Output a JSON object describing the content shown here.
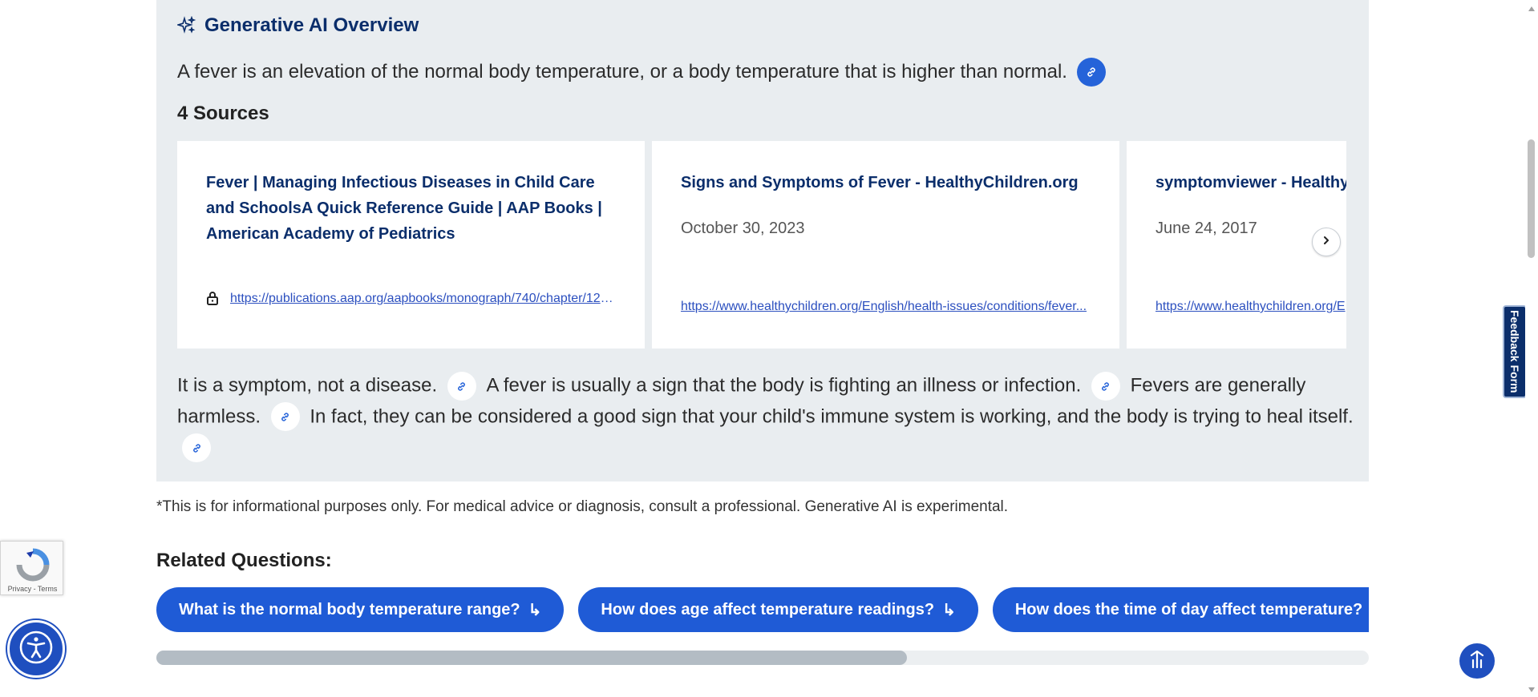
{
  "overview": {
    "title": "Generative AI Overview",
    "lead": "A fever is an elevation of the normal body temperature, or a body temperature that is higher than normal.",
    "sources_heading": "4 Sources",
    "cards": [
      {
        "title": "Fever | Managing Infectious Diseases in Child Care and SchoolsA Quick Reference Guide | AAP Books | American Academy of Pediatrics",
        "date": "",
        "url": "https://publications.aap.org/aapbooks/monograph/740/chapter/121..."
      },
      {
        "title": "Signs and Symptoms of Fever - HealthyChildren.org",
        "date": "October 30, 2023",
        "url": "https://www.healthychildren.org/English/health-issues/conditions/fever..."
      },
      {
        "title": "symptomviewer - HealthyC",
        "date": "June 24, 2017",
        "url": "https://www.healthychildren.org/E"
      }
    ],
    "body": {
      "s1": "It is a symptom, not a disease.",
      "s2": "A fever is usually a sign that the body is fighting an illness or infection.",
      "s3": "Fevers are generally harmless.",
      "s4": "In fact, they can be considered a good sign that your child's immune system is working, and the body is trying to heal itself."
    }
  },
  "disclaimer": "*This is for informational purposes only. For medical advice or diagnosis, consult a professional. Generative AI is experimental.",
  "related": {
    "heading": "Related Questions:",
    "questions": [
      "What is the normal body temperature range?",
      "How does age affect temperature readings?",
      "How does the time of day affect temperature?",
      ""
    ],
    "arrow": "↳"
  },
  "feedback_tab": "Feedback Form",
  "recaptcha": "Privacy - Terms",
  "colors": {
    "accent": "#1f5bd6",
    "navy": "#0b2e6b",
    "panel_bg": "#e9edf0"
  },
  "icons": [
    "sparkle-icon",
    "link-icon",
    "lock-icon",
    "chevron-right-icon",
    "accessibility-icon",
    "scroll-to-top-icon",
    "recaptcha-icon"
  ]
}
